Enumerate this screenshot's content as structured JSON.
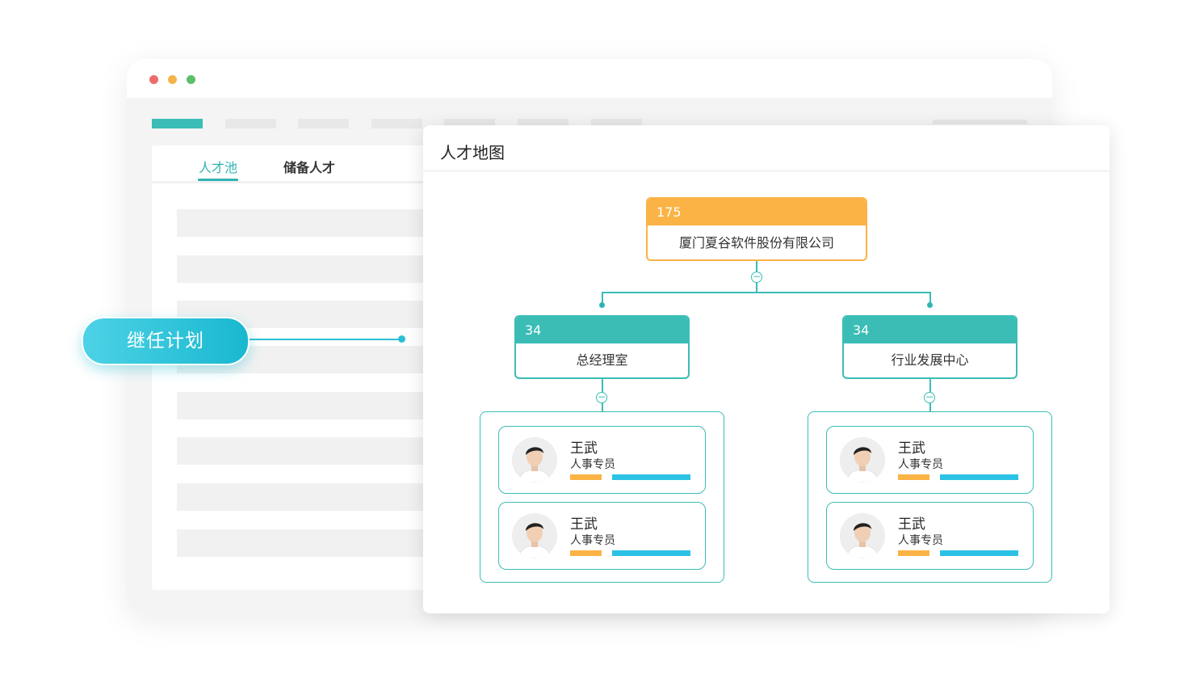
{
  "colors": {
    "teal": "#3bbdb6",
    "orange": "#fbb346",
    "cyan": "#2cc2e6",
    "window_dots": [
      "#ef6b6b",
      "#f3b54a",
      "#5cc06a"
    ]
  },
  "back_window": {
    "tabs": [
      {
        "label": "人才池",
        "active": true
      },
      {
        "label": "储备人才",
        "active": false
      }
    ]
  },
  "callout": {
    "label": "继任计划"
  },
  "talent_map": {
    "title": "人才地图",
    "root": {
      "count": "175",
      "name": "厦门夏谷软件股份有限公司"
    },
    "toggle_icon": "minus-circle-icon",
    "departments": [
      {
        "count": "34",
        "name": "总经理室",
        "people": [
          {
            "name": "王武",
            "role": "人事专员",
            "avatar": "person-avatar"
          },
          {
            "name": "王武",
            "role": "人事专员",
            "avatar": "person-avatar"
          }
        ]
      },
      {
        "count": "34",
        "name": "行业发展中心",
        "people": [
          {
            "name": "王武",
            "role": "人事专员",
            "avatar": "person-avatar"
          },
          {
            "name": "王武",
            "role": "人事专员",
            "avatar": "person-avatar"
          }
        ]
      }
    ]
  }
}
